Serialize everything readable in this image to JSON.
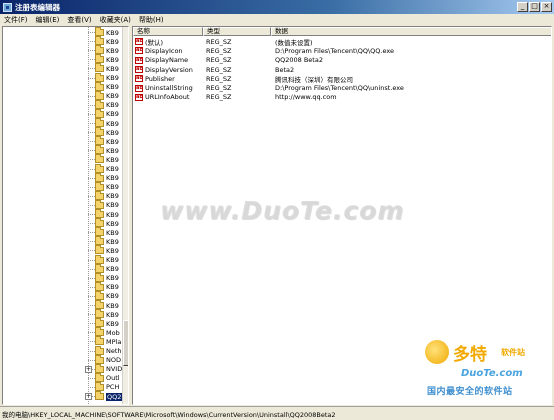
{
  "window": {
    "title": "注册表编辑器"
  },
  "menu": [
    "文件(F)",
    "编辑(E)",
    "查看(V)",
    "收藏夹(A)",
    "帮助(H)"
  ],
  "tree": {
    "items": [
      "KB9",
      "KB9",
      "KB9",
      "KB9",
      "KB9",
      "KB9",
      "KB9",
      "KB9",
      "KB9",
      "KB9",
      "KB9",
      "KB9",
      "KB9",
      "KB9",
      "KB9",
      "KB9",
      "KB9",
      "KB9",
      "KB9",
      "KB9",
      "KB9",
      "KB9",
      "KB9",
      "KB9",
      "KB9",
      "KB9",
      "KB9",
      "KB9",
      "KB9",
      "KB9",
      "KB9",
      "KB9",
      "KB9",
      "Mob",
      "MPla",
      "Neth",
      "NOD",
      "NVID",
      "Outl",
      "PCH",
      "QQ2"
    ]
  },
  "list": {
    "columns": [
      "名称",
      "类型",
      "数据"
    ],
    "rows": [
      {
        "name": "(默认)",
        "type": "REG_SZ",
        "data": "(数值未设置)"
      },
      {
        "name": "DisplayIcon",
        "type": "REG_SZ",
        "data": "D:\\Program Files\\Tencent\\QQ\\QQ.exe"
      },
      {
        "name": "DisplayName",
        "type": "REG_SZ",
        "data": "QQ2008 Beta2"
      },
      {
        "name": "DisplayVersion",
        "type": "REG_SZ",
        "data": "Beta2"
      },
      {
        "name": "Publisher",
        "type": "REG_SZ",
        "data": "腾讯科技（深圳）有限公司"
      },
      {
        "name": "UninstallString",
        "type": "REG_SZ",
        "data": "D:\\Program Files\\Tencent\\QQ\\uninst.exe"
      },
      {
        "name": "URLInfoAbout",
        "type": "REG_SZ",
        "data": "http://www.qq.com"
      }
    ]
  },
  "icons": {
    "value": "ab-icon",
    "folder": "folder-icon"
  },
  "watermark": {
    "text": "www.DuoTe.com"
  },
  "logo": {
    "main": "多特",
    "sub": "软件站",
    "site": "DuoTe.com",
    "tagline": "国内最安全的软件站"
  },
  "status": {
    "path": "我的电脑\\HKEY_LOCAL_MACHINE\\SOFTWARE\\Microsoft\\Windows\\CurrentVersion\\Uninstall\\QQ2008Beta2"
  },
  "colors": {
    "titlebar": "#0a246a",
    "selection": "#0a246a",
    "value_icon": "#c00000"
  }
}
